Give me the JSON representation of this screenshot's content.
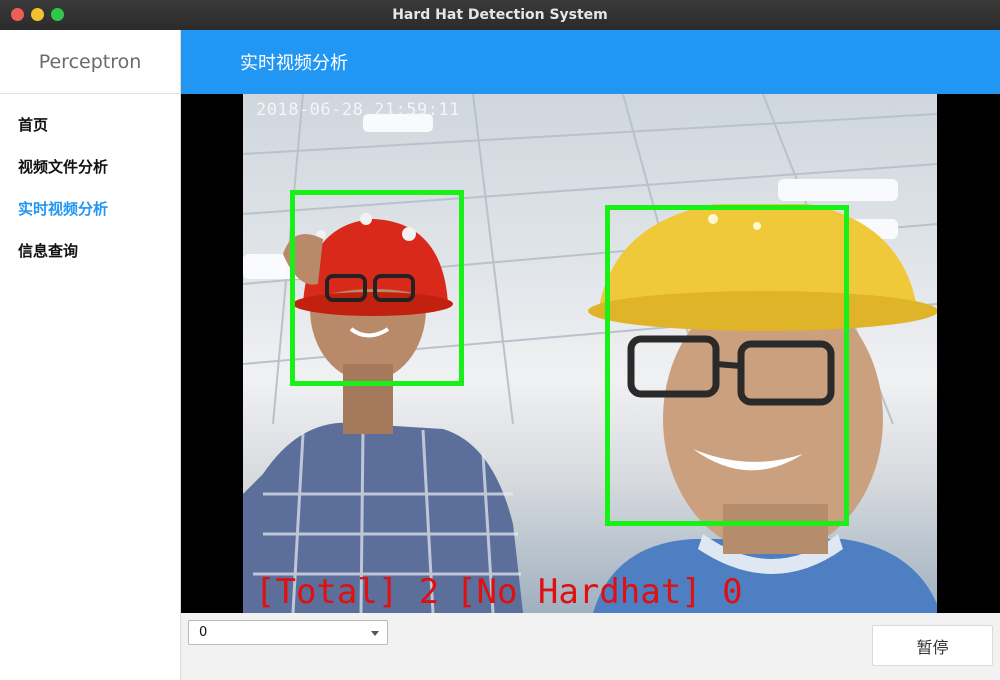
{
  "window": {
    "title": "Hard Hat Detection System"
  },
  "sidebar": {
    "brand": "Perceptron",
    "items": [
      {
        "label": "首页",
        "active": false
      },
      {
        "label": "视频文件分析",
        "active": false
      },
      {
        "label": "实时视频分析",
        "active": true
      },
      {
        "label": "信息查询",
        "active": false
      }
    ]
  },
  "header": {
    "title": "实时视频分析"
  },
  "video": {
    "timestamp": "2018-06-28 21:59:11",
    "total_label": "[Total] 2",
    "no_hardhat_label": "[No Hardhat] 0",
    "box_color": "#18f018",
    "overlay_color": "#e01010"
  },
  "controls": {
    "camera_select": {
      "value": "0"
    },
    "pause_label": "暂停"
  },
  "colors": {
    "accent": "#2196f3",
    "active_nav": "#2196f3"
  }
}
